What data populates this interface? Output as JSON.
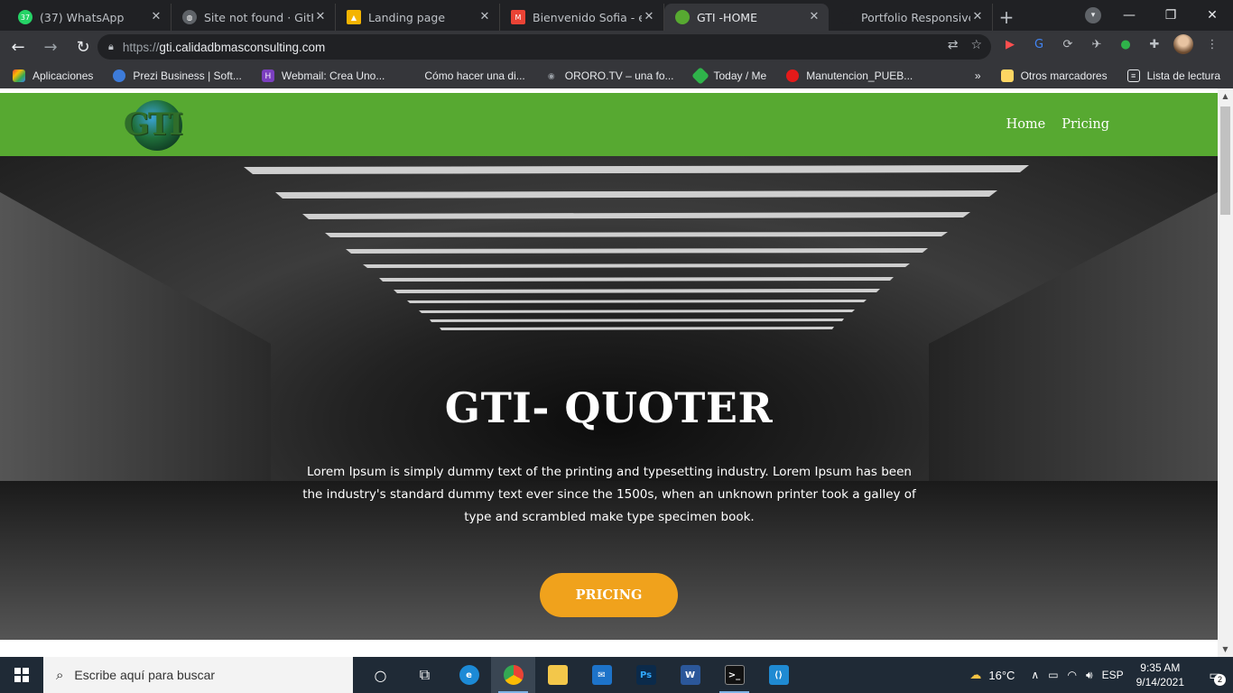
{
  "browser": {
    "tabs": [
      {
        "label": "(37) WhatsApp",
        "favicon_color": "#25d366",
        "favicon_text": "37"
      },
      {
        "label": "Site not found · GitHub",
        "favicon_color": "#5f6368",
        "favicon_text": ""
      },
      {
        "label": "Landing page",
        "favicon_color": "#f4b400",
        "favicon_text": ""
      },
      {
        "label": "Bienvenido Sofia - extr",
        "favicon_color": "#ea4335",
        "favicon_text": "M"
      },
      {
        "label": "GTI -HOME",
        "favicon_color": "#57a931",
        "favicon_text": ""
      },
      {
        "label": "Portfolio Responsive H",
        "favicon_color": "#202124",
        "favicon_text": ""
      }
    ],
    "url_scheme": "https://",
    "url_host": "gti.calidadbmasconsulting.com",
    "bookmarks": [
      {
        "label": "Aplicaciones",
        "icon_color": "#e94235"
      },
      {
        "label": "Prezi Business | Soft...",
        "icon_color": "#3d7bd9"
      },
      {
        "label": "Webmail: Crea Uno...",
        "icon_color": "#7b3fbf"
      },
      {
        "label": "Cómo hacer una di...",
        "icon_color": "#35363a"
      },
      {
        "label": "ORORO.TV – una fo...",
        "icon_color": "#9aa0a6"
      },
      {
        "label": "Today / Me",
        "icon_color": "#2fb34a"
      },
      {
        "label": "Manutencion_PUEB...",
        "icon_color": "#e51a1a"
      }
    ],
    "bookmarks_more": "»",
    "other_bookmarks": "Otros marcadores",
    "reading_list": "Lista de lectura"
  },
  "site": {
    "logo_text": "GTI",
    "nav": [
      "Home",
      "Pricing"
    ],
    "nav_color": "#57a931",
    "hero_title": "GTI- QUOTER",
    "hero_text": "Lorem Ipsum is simply dummy text of the printing and typesetting industry. Lorem Ipsum has been the industry's standard dummy text ever since the 1500s, when an unknown printer took a galley of type and scrambled make type specimen book.",
    "cta_label": "PRICING",
    "cta_color": "#f0a21c"
  },
  "taskbar": {
    "search_placeholder": "Escribe aquí para buscar",
    "temperature": "16°C",
    "language": "ESP",
    "time": "9:35 AM",
    "date": "9/14/2021",
    "notifications": "2"
  }
}
